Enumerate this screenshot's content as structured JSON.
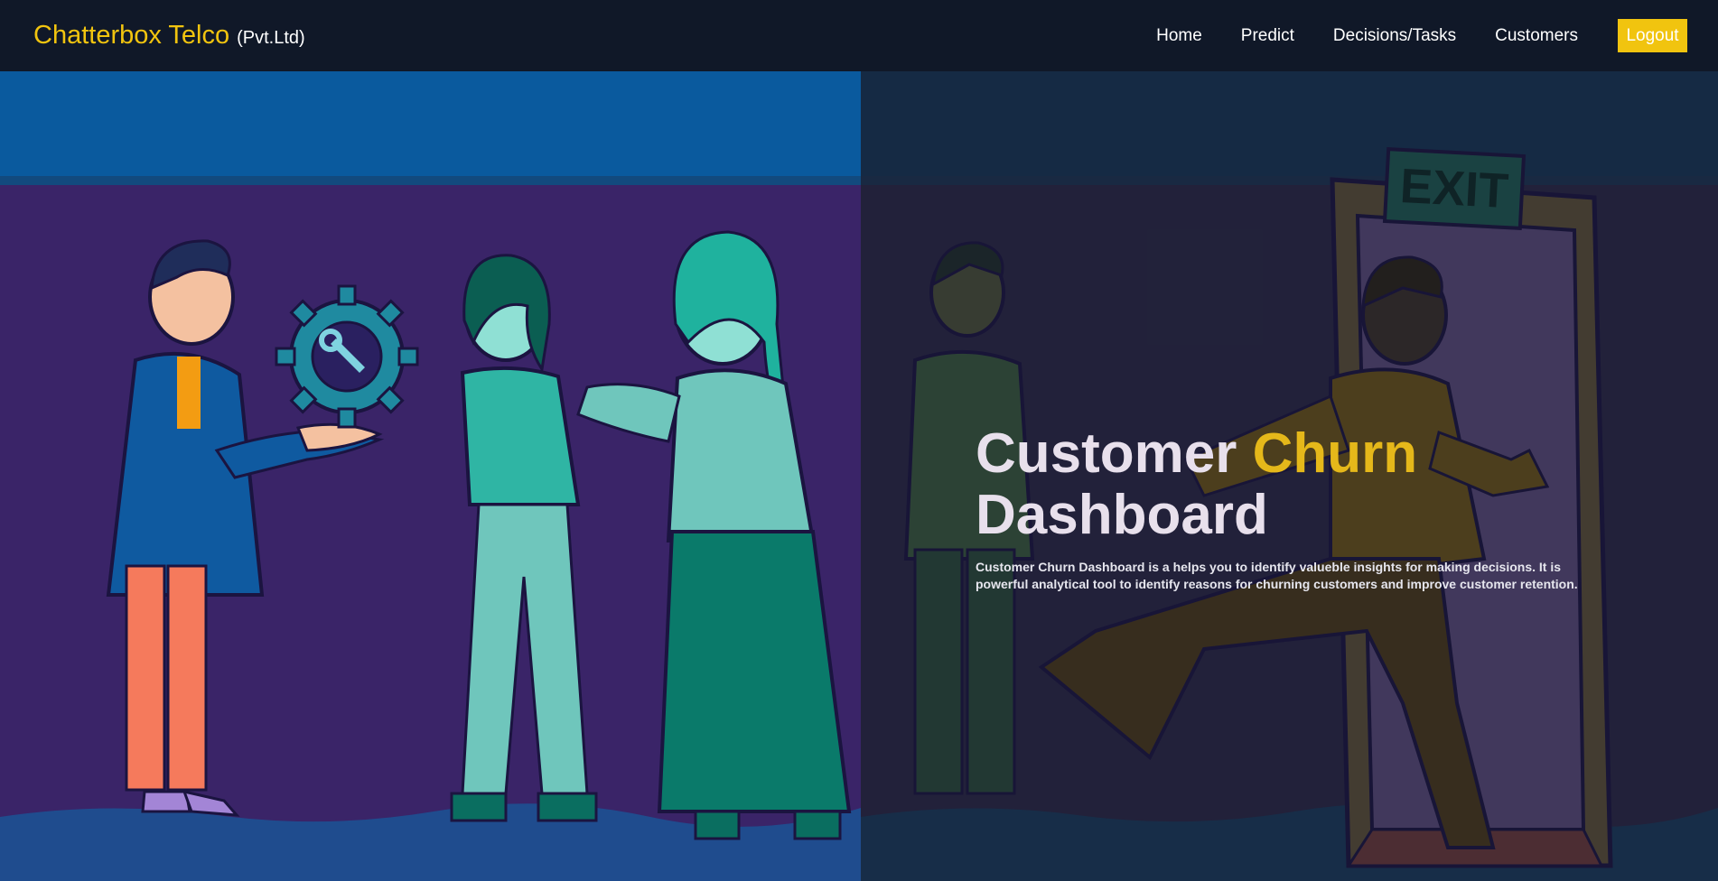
{
  "header": {
    "brand_name": "Chatterbox Telco",
    "brand_suffix": "(Pvt.Ltd)",
    "nav": [
      "Home",
      "Predict",
      "Decisions/Tasks",
      "Customers"
    ],
    "logout_label": "Logout"
  },
  "hero": {
    "title_part1": "Customer ",
    "title_accent": "Churn",
    "title_part2": "Dashboard",
    "description": "Customer Churn Dashboard is a helps you to identify valueble insights for making decisions. It is powerful analytical tool to identify reasons for churning customers and improve customer retention.",
    "exit_sign": "EXIT"
  },
  "colors": {
    "accent": "#f1c40f",
    "navbar_bg": "#101828",
    "left_panel_bg": "#3a2468",
    "right_panel_bg": "#2a2744"
  }
}
